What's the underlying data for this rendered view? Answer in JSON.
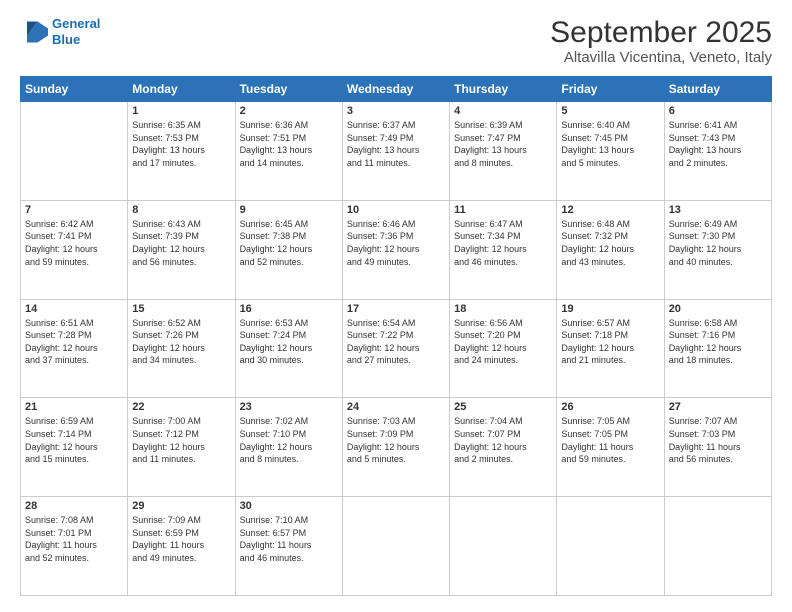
{
  "logo": {
    "line1": "General",
    "line2": "Blue"
  },
  "header": {
    "month": "September 2025",
    "location": "Altavilla Vicentina, Veneto, Italy"
  },
  "weekdays": [
    "Sunday",
    "Monday",
    "Tuesday",
    "Wednesday",
    "Thursday",
    "Friday",
    "Saturday"
  ],
  "weeks": [
    [
      {
        "day": null,
        "info": null
      },
      {
        "day": "1",
        "info": "Sunrise: 6:35 AM\nSunset: 7:53 PM\nDaylight: 13 hours\nand 17 minutes."
      },
      {
        "day": "2",
        "info": "Sunrise: 6:36 AM\nSunset: 7:51 PM\nDaylight: 13 hours\nand 14 minutes."
      },
      {
        "day": "3",
        "info": "Sunrise: 6:37 AM\nSunset: 7:49 PM\nDaylight: 13 hours\nand 11 minutes."
      },
      {
        "day": "4",
        "info": "Sunrise: 6:39 AM\nSunset: 7:47 PM\nDaylight: 13 hours\nand 8 minutes."
      },
      {
        "day": "5",
        "info": "Sunrise: 6:40 AM\nSunset: 7:45 PM\nDaylight: 13 hours\nand 5 minutes."
      },
      {
        "day": "6",
        "info": "Sunrise: 6:41 AM\nSunset: 7:43 PM\nDaylight: 13 hours\nand 2 minutes."
      }
    ],
    [
      {
        "day": "7",
        "info": "Sunrise: 6:42 AM\nSunset: 7:41 PM\nDaylight: 12 hours\nand 59 minutes."
      },
      {
        "day": "8",
        "info": "Sunrise: 6:43 AM\nSunset: 7:39 PM\nDaylight: 12 hours\nand 56 minutes."
      },
      {
        "day": "9",
        "info": "Sunrise: 6:45 AM\nSunset: 7:38 PM\nDaylight: 12 hours\nand 52 minutes."
      },
      {
        "day": "10",
        "info": "Sunrise: 6:46 AM\nSunset: 7:36 PM\nDaylight: 12 hours\nand 49 minutes."
      },
      {
        "day": "11",
        "info": "Sunrise: 6:47 AM\nSunset: 7:34 PM\nDaylight: 12 hours\nand 46 minutes."
      },
      {
        "day": "12",
        "info": "Sunrise: 6:48 AM\nSunset: 7:32 PM\nDaylight: 12 hours\nand 43 minutes."
      },
      {
        "day": "13",
        "info": "Sunrise: 6:49 AM\nSunset: 7:30 PM\nDaylight: 12 hours\nand 40 minutes."
      }
    ],
    [
      {
        "day": "14",
        "info": "Sunrise: 6:51 AM\nSunset: 7:28 PM\nDaylight: 12 hours\nand 37 minutes."
      },
      {
        "day": "15",
        "info": "Sunrise: 6:52 AM\nSunset: 7:26 PM\nDaylight: 12 hours\nand 34 minutes."
      },
      {
        "day": "16",
        "info": "Sunrise: 6:53 AM\nSunset: 7:24 PM\nDaylight: 12 hours\nand 30 minutes."
      },
      {
        "day": "17",
        "info": "Sunrise: 6:54 AM\nSunset: 7:22 PM\nDaylight: 12 hours\nand 27 minutes."
      },
      {
        "day": "18",
        "info": "Sunrise: 6:56 AM\nSunset: 7:20 PM\nDaylight: 12 hours\nand 24 minutes."
      },
      {
        "day": "19",
        "info": "Sunrise: 6:57 AM\nSunset: 7:18 PM\nDaylight: 12 hours\nand 21 minutes."
      },
      {
        "day": "20",
        "info": "Sunrise: 6:58 AM\nSunset: 7:16 PM\nDaylight: 12 hours\nand 18 minutes."
      }
    ],
    [
      {
        "day": "21",
        "info": "Sunrise: 6:59 AM\nSunset: 7:14 PM\nDaylight: 12 hours\nand 15 minutes."
      },
      {
        "day": "22",
        "info": "Sunrise: 7:00 AM\nSunset: 7:12 PM\nDaylight: 12 hours\nand 11 minutes."
      },
      {
        "day": "23",
        "info": "Sunrise: 7:02 AM\nSunset: 7:10 PM\nDaylight: 12 hours\nand 8 minutes."
      },
      {
        "day": "24",
        "info": "Sunrise: 7:03 AM\nSunset: 7:09 PM\nDaylight: 12 hours\nand 5 minutes."
      },
      {
        "day": "25",
        "info": "Sunrise: 7:04 AM\nSunset: 7:07 PM\nDaylight: 12 hours\nand 2 minutes."
      },
      {
        "day": "26",
        "info": "Sunrise: 7:05 AM\nSunset: 7:05 PM\nDaylight: 11 hours\nand 59 minutes."
      },
      {
        "day": "27",
        "info": "Sunrise: 7:07 AM\nSunset: 7:03 PM\nDaylight: 11 hours\nand 56 minutes."
      }
    ],
    [
      {
        "day": "28",
        "info": "Sunrise: 7:08 AM\nSunset: 7:01 PM\nDaylight: 11 hours\nand 52 minutes."
      },
      {
        "day": "29",
        "info": "Sunrise: 7:09 AM\nSunset: 6:59 PM\nDaylight: 11 hours\nand 49 minutes."
      },
      {
        "day": "30",
        "info": "Sunrise: 7:10 AM\nSunset: 6:57 PM\nDaylight: 11 hours\nand 46 minutes."
      },
      {
        "day": null,
        "info": null
      },
      {
        "day": null,
        "info": null
      },
      {
        "day": null,
        "info": null
      },
      {
        "day": null,
        "info": null
      }
    ]
  ]
}
